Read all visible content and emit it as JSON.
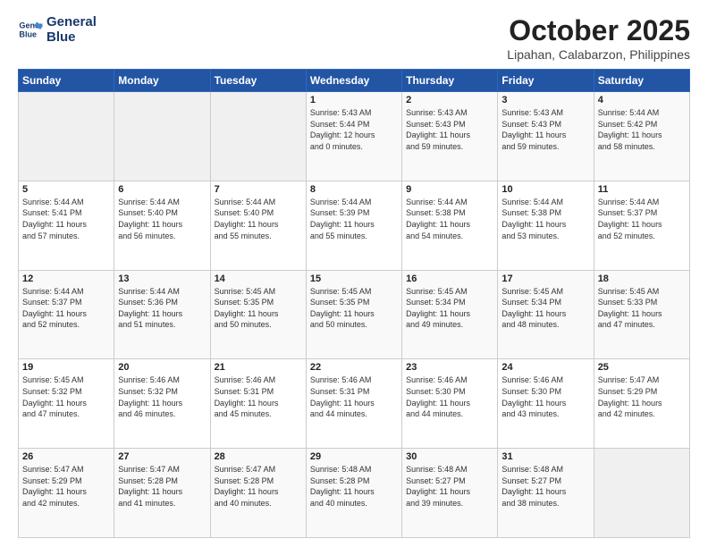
{
  "header": {
    "logo_line1": "General",
    "logo_line2": "Blue",
    "month": "October 2025",
    "location": "Lipahan, Calabarzon, Philippines"
  },
  "weekdays": [
    "Sunday",
    "Monday",
    "Tuesday",
    "Wednesday",
    "Thursday",
    "Friday",
    "Saturday"
  ],
  "weeks": [
    [
      {
        "day": "",
        "info": ""
      },
      {
        "day": "",
        "info": ""
      },
      {
        "day": "",
        "info": ""
      },
      {
        "day": "1",
        "info": "Sunrise: 5:43 AM\nSunset: 5:44 PM\nDaylight: 12 hours\nand 0 minutes."
      },
      {
        "day": "2",
        "info": "Sunrise: 5:43 AM\nSunset: 5:43 PM\nDaylight: 11 hours\nand 59 minutes."
      },
      {
        "day": "3",
        "info": "Sunrise: 5:43 AM\nSunset: 5:43 PM\nDaylight: 11 hours\nand 59 minutes."
      },
      {
        "day": "4",
        "info": "Sunrise: 5:44 AM\nSunset: 5:42 PM\nDaylight: 11 hours\nand 58 minutes."
      }
    ],
    [
      {
        "day": "5",
        "info": "Sunrise: 5:44 AM\nSunset: 5:41 PM\nDaylight: 11 hours\nand 57 minutes."
      },
      {
        "day": "6",
        "info": "Sunrise: 5:44 AM\nSunset: 5:40 PM\nDaylight: 11 hours\nand 56 minutes."
      },
      {
        "day": "7",
        "info": "Sunrise: 5:44 AM\nSunset: 5:40 PM\nDaylight: 11 hours\nand 55 minutes."
      },
      {
        "day": "8",
        "info": "Sunrise: 5:44 AM\nSunset: 5:39 PM\nDaylight: 11 hours\nand 55 minutes."
      },
      {
        "day": "9",
        "info": "Sunrise: 5:44 AM\nSunset: 5:38 PM\nDaylight: 11 hours\nand 54 minutes."
      },
      {
        "day": "10",
        "info": "Sunrise: 5:44 AM\nSunset: 5:38 PM\nDaylight: 11 hours\nand 53 minutes."
      },
      {
        "day": "11",
        "info": "Sunrise: 5:44 AM\nSunset: 5:37 PM\nDaylight: 11 hours\nand 52 minutes."
      }
    ],
    [
      {
        "day": "12",
        "info": "Sunrise: 5:44 AM\nSunset: 5:37 PM\nDaylight: 11 hours\nand 52 minutes."
      },
      {
        "day": "13",
        "info": "Sunrise: 5:44 AM\nSunset: 5:36 PM\nDaylight: 11 hours\nand 51 minutes."
      },
      {
        "day": "14",
        "info": "Sunrise: 5:45 AM\nSunset: 5:35 PM\nDaylight: 11 hours\nand 50 minutes."
      },
      {
        "day": "15",
        "info": "Sunrise: 5:45 AM\nSunset: 5:35 PM\nDaylight: 11 hours\nand 50 minutes."
      },
      {
        "day": "16",
        "info": "Sunrise: 5:45 AM\nSunset: 5:34 PM\nDaylight: 11 hours\nand 49 minutes."
      },
      {
        "day": "17",
        "info": "Sunrise: 5:45 AM\nSunset: 5:34 PM\nDaylight: 11 hours\nand 48 minutes."
      },
      {
        "day": "18",
        "info": "Sunrise: 5:45 AM\nSunset: 5:33 PM\nDaylight: 11 hours\nand 47 minutes."
      }
    ],
    [
      {
        "day": "19",
        "info": "Sunrise: 5:45 AM\nSunset: 5:32 PM\nDaylight: 11 hours\nand 47 minutes."
      },
      {
        "day": "20",
        "info": "Sunrise: 5:46 AM\nSunset: 5:32 PM\nDaylight: 11 hours\nand 46 minutes."
      },
      {
        "day": "21",
        "info": "Sunrise: 5:46 AM\nSunset: 5:31 PM\nDaylight: 11 hours\nand 45 minutes."
      },
      {
        "day": "22",
        "info": "Sunrise: 5:46 AM\nSunset: 5:31 PM\nDaylight: 11 hours\nand 44 minutes."
      },
      {
        "day": "23",
        "info": "Sunrise: 5:46 AM\nSunset: 5:30 PM\nDaylight: 11 hours\nand 44 minutes."
      },
      {
        "day": "24",
        "info": "Sunrise: 5:46 AM\nSunset: 5:30 PM\nDaylight: 11 hours\nand 43 minutes."
      },
      {
        "day": "25",
        "info": "Sunrise: 5:47 AM\nSunset: 5:29 PM\nDaylight: 11 hours\nand 42 minutes."
      }
    ],
    [
      {
        "day": "26",
        "info": "Sunrise: 5:47 AM\nSunset: 5:29 PM\nDaylight: 11 hours\nand 42 minutes."
      },
      {
        "day": "27",
        "info": "Sunrise: 5:47 AM\nSunset: 5:28 PM\nDaylight: 11 hours\nand 41 minutes."
      },
      {
        "day": "28",
        "info": "Sunrise: 5:47 AM\nSunset: 5:28 PM\nDaylight: 11 hours\nand 40 minutes."
      },
      {
        "day": "29",
        "info": "Sunrise: 5:48 AM\nSunset: 5:28 PM\nDaylight: 11 hours\nand 40 minutes."
      },
      {
        "day": "30",
        "info": "Sunrise: 5:48 AM\nSunset: 5:27 PM\nDaylight: 11 hours\nand 39 minutes."
      },
      {
        "day": "31",
        "info": "Sunrise: 5:48 AM\nSunset: 5:27 PM\nDaylight: 11 hours\nand 38 minutes."
      },
      {
        "day": "",
        "info": ""
      }
    ]
  ]
}
